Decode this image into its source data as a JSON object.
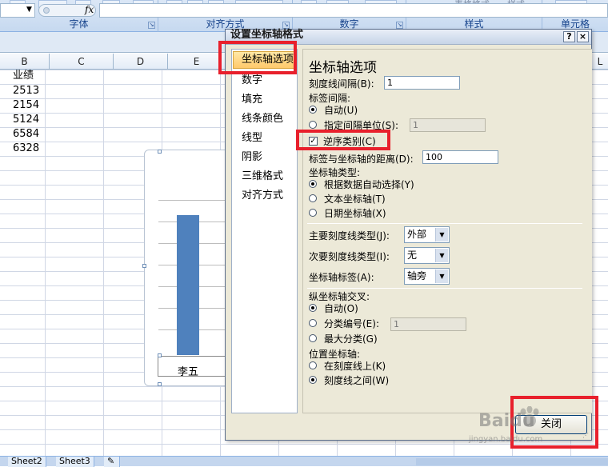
{
  "ribbon": {
    "groups": [
      "字体",
      "对齐方式",
      "数字",
      "样式",
      "单元格"
    ],
    "style_buttons": [
      "表格格式",
      "样式"
    ]
  },
  "formula_bar": {
    "fx_symbol": "fx",
    "name_box_value": "",
    "formula_value": ""
  },
  "columns": [
    "B",
    "C",
    "D",
    "E",
    "L"
  ],
  "sheet_values": {
    "header": "业绩",
    "rows": [
      "2513",
      "2154",
      "5124",
      "6584",
      "6328"
    ]
  },
  "chart": {
    "bar_category": "李五",
    "bar_color": "#4f81bd"
  },
  "sheets": [
    "Sheet2",
    "Sheet3"
  ],
  "dialog": {
    "title": "设置坐标轴格式",
    "help_label": "?",
    "close_label": "×",
    "nav_items": [
      "坐标轴选项",
      "数字",
      "填充",
      "线条颜色",
      "线型",
      "阴影",
      "三维格式",
      "对齐方式"
    ],
    "selected_nav": "坐标轴选项",
    "content_title": "坐标轴选项",
    "tick_interval_label": "刻度线间隔(B):",
    "tick_interval_value": "1",
    "label_interval_label": "标签间隔:",
    "auto_label": "自动(U)",
    "specify_unit_label": "指定间隔单位(S):",
    "specify_unit_value": "1",
    "reverse_label": "逆序类别(C)",
    "reverse_checked": true,
    "label_distance_label": "标签与坐标轴的距离(D):",
    "label_distance_value": "100",
    "axis_type_label": "坐标轴类型:",
    "axis_type_options": [
      "根据数据自动选择(Y)",
      "文本坐标轴(T)",
      "日期坐标轴(X)"
    ],
    "major_tick_label": "主要刻度线类型(J):",
    "major_tick_value": "外部",
    "minor_tick_label": "次要刻度线类型(I):",
    "minor_tick_value": "无",
    "axis_labels_label": "坐标轴标签(A):",
    "axis_labels_value": "轴旁",
    "vertical_cross_label": "纵坐标轴交叉:",
    "cross_options": [
      "自动(O)",
      "分类编号(E):",
      "最大分类(G)"
    ],
    "cross_category_value": "1",
    "position_label": "位置坐标轴:",
    "position_options": [
      "在刻度线上(K)",
      "刻度线之间(W)"
    ],
    "close_button_label": "关闭"
  },
  "annotations": {
    "highlight_color": "#e8202c"
  },
  "watermark": {
    "brand": "Baidu",
    "sub": "jingyan.baidu.com"
  }
}
